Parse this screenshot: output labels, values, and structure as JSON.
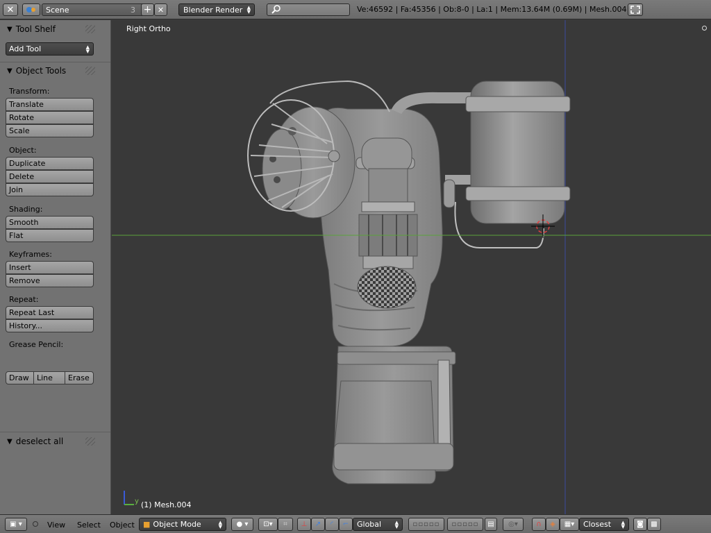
{
  "header": {
    "scene_name": "Scene",
    "scene_users": "3",
    "render_engine": "Blender Render",
    "search_placeholder": "",
    "stats": "Ve:46592 | Fa:45356 | Ob:8-0 | La:1 | Mem:13.64M (0.69M) | Mesh.004"
  },
  "toolshelf": {
    "title": "Tool Shelf",
    "add_tool": "Add Tool",
    "object_tools_title": "Object Tools",
    "sections": {
      "transform": "Transform:",
      "object": "Object:",
      "shading": "Shading:",
      "keyframes": "Keyframes:",
      "repeat": "Repeat:",
      "grease_pencil": "Grease Pencil:"
    },
    "buttons": {
      "translate": "Translate",
      "rotate": "Rotate",
      "scale": "Scale",
      "duplicate": "Duplicate",
      "delete": "Delete",
      "join": "Join",
      "smooth": "Smooth",
      "flat": "Flat",
      "insert": "Insert",
      "remove": "Remove",
      "repeat_last": "Repeat Last",
      "history": "History...",
      "draw": "Draw",
      "line": "Line",
      "erase": "Erase"
    },
    "last_operator": "deselect all"
  },
  "viewport": {
    "view_name": "Right Ortho",
    "active_object": "(1) Mesh.004",
    "axis_y_label": "y",
    "colors": {
      "background": "#393939",
      "mesh": "#8c8c8c",
      "y_axis_line": "#5aa23a",
      "z_axis_line": "#3a4aa0"
    }
  },
  "footer": {
    "menus": {
      "view": "View",
      "select": "Select",
      "object": "Object"
    },
    "mode": "Object Mode",
    "orientation": "Global",
    "snap_target": "Closest"
  }
}
